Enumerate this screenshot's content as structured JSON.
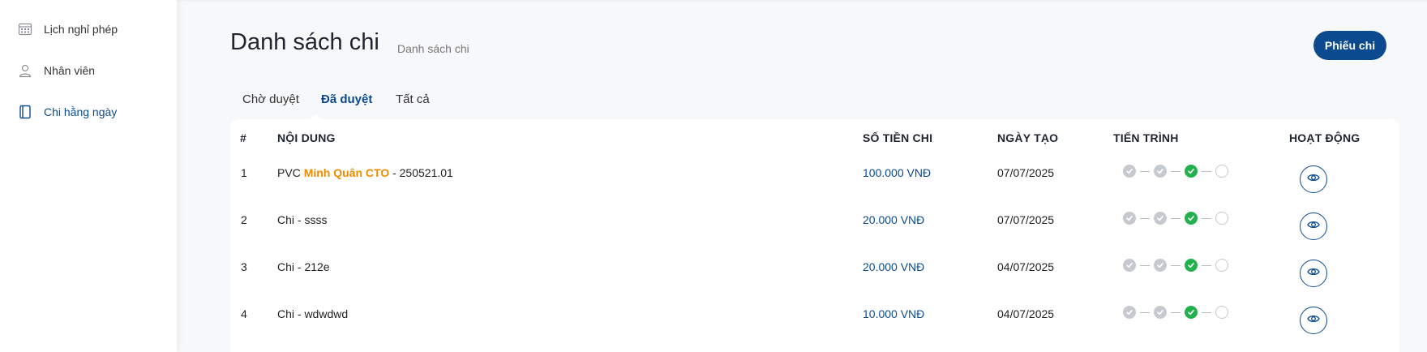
{
  "sidebar": {
    "items": [
      {
        "label": "Lịch nghỉ phép",
        "icon": "calendar-icon",
        "active": false
      },
      {
        "label": "Nhân viên",
        "icon": "user-icon",
        "active": false
      },
      {
        "label": "Chi hằng ngày",
        "icon": "book-icon",
        "active": true
      }
    ]
  },
  "header": {
    "title": "Danh sách chi",
    "subtitle": "Danh sách chi",
    "action_label": "Phiếu chi"
  },
  "tabs": [
    {
      "label": "Chờ duyệt",
      "active": false
    },
    {
      "label": "Đã duyệt",
      "active": true
    },
    {
      "label": "Tất cả",
      "active": false
    }
  ],
  "table": {
    "columns": [
      "#",
      "NỘI DUNG",
      "SỐ TIỀN CHI",
      "NGÀY TẠO",
      "TIẾN TRÌNH",
      "HOẠT ĐỘNG"
    ],
    "rows": [
      {
        "index": "1",
        "content_prefix": "PVC ",
        "content_highlight": "Minh Quân CTO",
        "content_suffix": " - 250521.01",
        "amount": "100.000 VNĐ",
        "date": "07/07/2025",
        "progress": [
          "done",
          "done",
          "current",
          "empty"
        ]
      },
      {
        "index": "2",
        "content_prefix": "Chi - ssss",
        "content_highlight": "",
        "content_suffix": "",
        "amount": "20.000 VNĐ",
        "date": "07/07/2025",
        "progress": [
          "done",
          "done",
          "current",
          "empty"
        ]
      },
      {
        "index": "3",
        "content_prefix": "Chi - 212e",
        "content_highlight": "",
        "content_suffix": "",
        "amount": "20.000 VNĐ",
        "date": "04/07/2025",
        "progress": [
          "done",
          "done",
          "current",
          "empty"
        ]
      },
      {
        "index": "4",
        "content_prefix": "Chi - wdwdwd",
        "content_highlight": "",
        "content_suffix": "",
        "amount": "10.000 VNĐ",
        "date": "04/07/2025",
        "progress": [
          "done",
          "done",
          "current",
          "empty"
        ]
      }
    ]
  },
  "colors": {
    "primary": "#0b4a8f",
    "highlight": "#f08c00",
    "step_done": "#c6cacf",
    "step_current": "#22b14c"
  }
}
